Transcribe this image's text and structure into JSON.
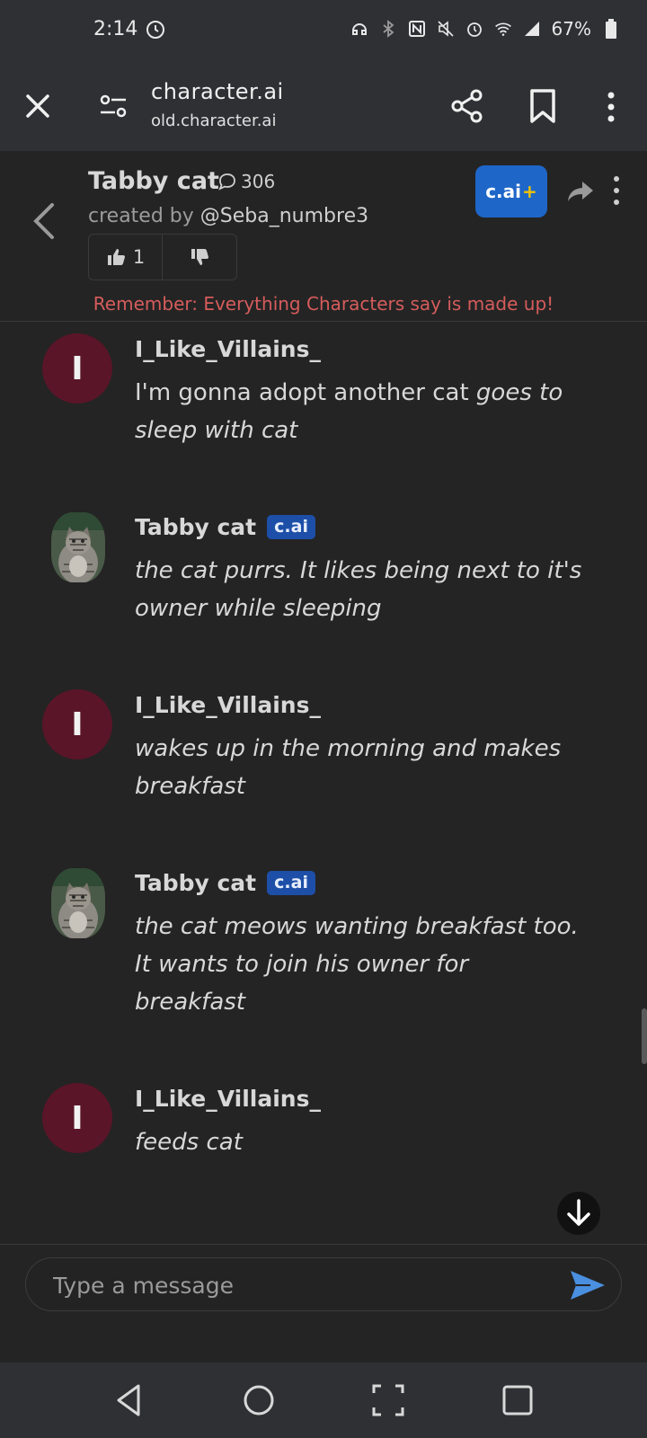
{
  "status_bar": {
    "time": "2:14",
    "battery": "67%"
  },
  "browser": {
    "site_title": "character.ai",
    "site_url": "old.character.ai"
  },
  "character": {
    "name": "Tabby cat",
    "chat_count": "306",
    "created_by_prefix": "created by",
    "creator": "@Seba_numbre3",
    "likes": "1",
    "plus_label": "c.ai",
    "plus_sign": "+",
    "disclaimer": "Remember: Everything Characters say is made up!"
  },
  "badge_label": "c.ai",
  "messages": [
    {
      "author": "I_Like_Villains_",
      "initial": "I",
      "type": "user",
      "text_plain": "I'm gonna adopt another cat ",
      "text_italic": "goes to sleep with cat"
    },
    {
      "author": "Tabby cat",
      "type": "character",
      "text_plain": "",
      "text_italic": "the cat purrs. It likes being next to it's owner while sleeping"
    },
    {
      "author": "I_Like_Villains_",
      "initial": "I",
      "type": "user",
      "text_plain": "",
      "text_italic": "wakes up in the morning and makes breakfast"
    },
    {
      "author": "Tabby cat",
      "type": "character",
      "text_plain": "",
      "text_italic": "the cat meows wanting breakfast too. It wants to join his owner for breakfast"
    },
    {
      "author": "I_Like_Villains_",
      "initial": "I",
      "type": "user",
      "text_plain": "",
      "text_italic": "feeds cat"
    }
  ],
  "composer": {
    "placeholder": "Type a message"
  },
  "colors": {
    "user_avatar": "#5a1528",
    "accent_blue": "#1e66c8",
    "disclaimer_red": "#d65c5c"
  }
}
